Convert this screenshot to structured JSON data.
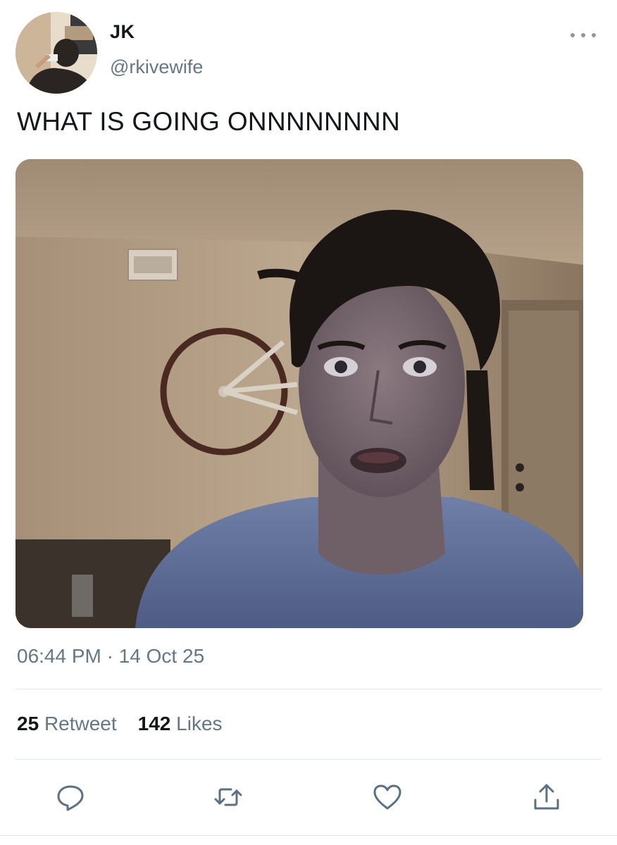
{
  "author": {
    "display_name": "JK",
    "handle": "@rkivewife"
  },
  "tweet": {
    "text": "WHAT IS GOING ONNNNNNNN",
    "timestamp": "06:44 PM · 14 Oct 25"
  },
  "stats": {
    "retweets_count": "25",
    "retweets_label": "Retweet",
    "likes_count": "142",
    "likes_label": "Likes"
  },
  "icons": {
    "more": "more-icon",
    "reply": "reply-icon",
    "retweet": "retweet-icon",
    "like": "heart-icon",
    "share": "share-icon"
  },
  "colors": {
    "text_primary": "#14171a",
    "text_secondary": "#657786",
    "icon": "#5b7083",
    "divider": "#e1e8ed"
  }
}
